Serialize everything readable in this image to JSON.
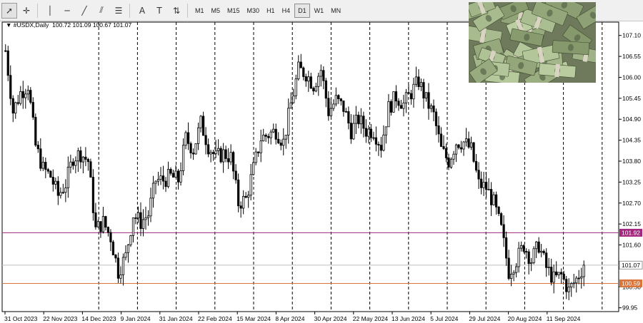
{
  "toolbar": {
    "tools": [
      {
        "name": "cursor-icon",
        "glyph": "➚",
        "active": true
      },
      {
        "name": "crosshair-icon",
        "glyph": "✛",
        "active": false
      },
      {
        "name": "vertical-line-icon",
        "glyph": "│",
        "active": false
      },
      {
        "name": "horizontal-line-icon",
        "glyph": "─",
        "active": false
      },
      {
        "name": "trendline-icon",
        "glyph": "╱",
        "active": false
      },
      {
        "name": "equidistant-channel-icon",
        "glyph": "⫽",
        "active": false
      },
      {
        "name": "fibonacci-icon",
        "glyph": "☰",
        "active": false
      },
      {
        "name": "text-icon",
        "glyph": "A",
        "active": false
      },
      {
        "name": "text-label-icon",
        "glyph": "T",
        "active": false
      },
      {
        "name": "arrows-icon",
        "glyph": "⇅",
        "active": false
      }
    ],
    "timeframes": [
      "M1",
      "M5",
      "M15",
      "M30",
      "H1",
      "H4",
      "D1",
      "W1",
      "MN"
    ],
    "active_timeframe": "D1"
  },
  "symbol": {
    "name": "#USDX,Daily",
    "ohlc": "100.72 101.09 100.67 101.07"
  },
  "price_labels": {
    "magenta_line": "101.92",
    "current": "101.07",
    "orange_line": "100.59"
  },
  "colors": {
    "magenta": "#a3267f",
    "orange": "#d9743a",
    "current_line": "#c0c0c0",
    "candle": "#000000"
  },
  "chart_data": {
    "type": "candlestick",
    "symbol": "#USDX",
    "timeframe": "Daily",
    "y_ticks": [
      "107.10",
      "106.55",
      "106.00",
      "105.45",
      "104.90",
      "104.35",
      "103.80",
      "103.25",
      "102.70",
      "102.15",
      "101.60",
      "101.05",
      "100.50",
      "99.95"
    ],
    "ylim": [
      99.85,
      107.45
    ],
    "x_ticks": [
      "31 Oct 2023",
      "22 Nov 2023",
      "14 Dec 2023",
      "9 Jan 2024",
      "31 Jan 2024",
      "22 Feb 2024",
      "15 Mar 2024",
      "8 Apr 2024",
      "30 Apr 2024",
      "22 May 2024",
      "13 Jun 2024",
      "5 Jul 2024",
      "29 Jul 2024",
      "20 Aug 2024",
      "11 Sep 2024"
    ],
    "horizontal_lines": [
      {
        "value": 101.92,
        "color": "#a3267f"
      },
      {
        "value": 100.59,
        "color": "#d9743a"
      },
      {
        "value": 101.07,
        "color": "#c0c0c0"
      }
    ],
    "close_path": [
      [
        "31 Oct 2023",
        106.7
      ],
      [
        "3 Nov 2023",
        105.1
      ],
      [
        "8 Nov 2023",
        105.6
      ],
      [
        "13 Nov 2023",
        105.8
      ],
      [
        "15 Nov 2023",
        104.2
      ],
      [
        "20 Nov 2023",
        103.6
      ],
      [
        "24 Nov 2023",
        103.4
      ],
      [
        "28 Nov 2023",
        102.9
      ],
      [
        "1 Dec 2023",
        103.2
      ],
      [
        "5 Dec 2023",
        103.9
      ],
      [
        "8 Dec 2023",
        104.0
      ],
      [
        "12 Dec 2023",
        103.8
      ],
      [
        "14 Dec 2023",
        102.0
      ],
      [
        "19 Dec 2023",
        102.2
      ],
      [
        "22 Dec 2023",
        101.8
      ],
      [
        "27 Dec 2023",
        100.9
      ],
      [
        "29 Dec 2023",
        101.3
      ],
      [
        "3 Jan 2024",
        102.4
      ],
      [
        "8 Jan 2024",
        102.2
      ],
      [
        "12 Jan 2024",
        102.4
      ],
      [
        "17 Jan 2024",
        103.3
      ],
      [
        "22 Jan 2024",
        103.3
      ],
      [
        "26 Jan 2024",
        103.4
      ],
      [
        "31 Jan 2024",
        103.3
      ],
      [
        "5 Feb 2024",
        104.4
      ],
      [
        "9 Feb 2024",
        104.1
      ],
      [
        "14 Feb 2024",
        104.8
      ],
      [
        "19 Feb 2024",
        104.2
      ],
      [
        "23 Feb 2024",
        103.9
      ],
      [
        "28 Feb 2024",
        104.0
      ],
      [
        "4 Mar 2024",
        103.9
      ],
      [
        "8 Mar 2024",
        102.7
      ],
      [
        "13 Mar 2024",
        102.8
      ],
      [
        "18 Mar 2024",
        103.6
      ],
      [
        "22 Mar 2024",
        104.4
      ],
      [
        "27 Mar 2024",
        104.5
      ],
      [
        "1 Apr 2024",
        104.6
      ],
      [
        "5 Apr 2024",
        104.3
      ],
      [
        "10 Apr 2024",
        105.3
      ],
      [
        "15 Apr 2024",
        106.2
      ],
      [
        "19 Apr 2024",
        106.1
      ],
      [
        "24 Apr 2024",
        105.8
      ],
      [
        "29 Apr 2024",
        106.2
      ],
      [
        "3 May 2024",
        105.1
      ],
      [
        "8 May 2024",
        105.4
      ],
      [
        "13 May 2024",
        105.2
      ],
      [
        "17 May 2024",
        104.6
      ],
      [
        "22 May 2024",
        104.9
      ],
      [
        "27 May 2024",
        104.6
      ],
      [
        "31 May 2024",
        104.6
      ],
      [
        "5 Jun 2024",
        104.2
      ],
      [
        "10 Jun 2024",
        105.2
      ],
      [
        "14 Jun 2024",
        105.5
      ],
      [
        "19 Jun 2024",
        105.3
      ],
      [
        "24 Jun 2024",
        105.6
      ],
      [
        "28 Jun 2024",
        105.9
      ],
      [
        "3 Jul 2024",
        105.4
      ],
      [
        "8 Jul 2024",
        105.0
      ],
      [
        "12 Jul 2024",
        104.1
      ],
      [
        "17 Jul 2024",
        103.8
      ],
      [
        "22 Jul 2024",
        104.3
      ],
      [
        "26 Jul 2024",
        104.3
      ],
      [
        "31 Jul 2024",
        104.1
      ],
      [
        "5 Aug 2024",
        103.2
      ],
      [
        "9 Aug 2024",
        103.1
      ],
      [
        "14 Aug 2024",
        102.7
      ],
      [
        "19 Aug 2024",
        102.0
      ],
      [
        "23 Aug 2024",
        100.9
      ],
      [
        "28 Aug 2024",
        101.2
      ],
      [
        "2 Sep 2024",
        101.6
      ],
      [
        "6 Sep 2024",
        101.2
      ],
      [
        "11 Sep 2024",
        101.6
      ],
      [
        "16 Sep 2024",
        101.0
      ],
      [
        "20 Sep 2024",
        100.7
      ],
      [
        "25 Sep 2024",
        100.8
      ],
      [
        "27 Sep 2024",
        100.4
      ],
      [
        "1 Oct 2024",
        100.7
      ],
      [
        "2 Oct 2024",
        101.07
      ]
    ]
  }
}
